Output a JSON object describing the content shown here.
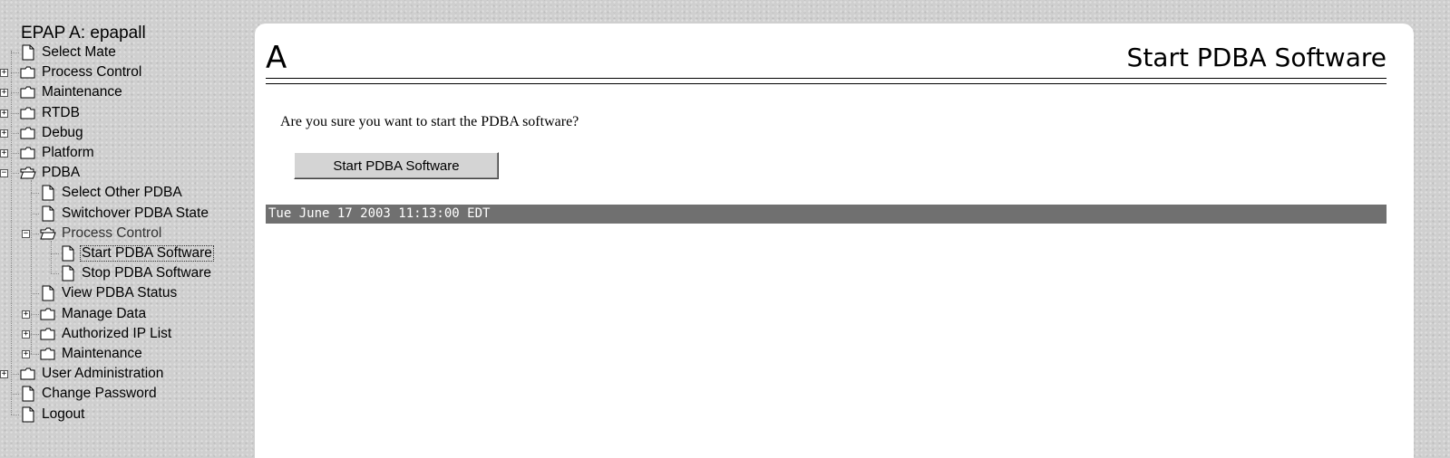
{
  "sidebar": {
    "title": "EPAP A: epapall",
    "items": [
      {
        "label": "Select Mate",
        "type": "page",
        "expander": ""
      },
      {
        "label": "Process Control",
        "type": "folder",
        "expander": "+"
      },
      {
        "label": "Maintenance",
        "type": "folder",
        "expander": "+"
      },
      {
        "label": "RTDB",
        "type": "folder",
        "expander": "+"
      },
      {
        "label": "Debug",
        "type": "folder",
        "expander": "+"
      },
      {
        "label": "Platform",
        "type": "folder",
        "expander": "+"
      },
      {
        "label": "PDBA",
        "type": "folder-open",
        "expander": "−"
      },
      {
        "label": "Select Other PDBA",
        "type": "page",
        "expander": ""
      },
      {
        "label": "Switchover PDBA State",
        "type": "page",
        "expander": ""
      },
      {
        "label": "Process Control",
        "type": "folder-open",
        "expander": "−"
      },
      {
        "label": "Start PDBA Software",
        "type": "page",
        "expander": ""
      },
      {
        "label": "Stop PDBA Software",
        "type": "page",
        "expander": ""
      },
      {
        "label": "View PDBA Status",
        "type": "page",
        "expander": ""
      },
      {
        "label": "Manage Data",
        "type": "folder",
        "expander": "+"
      },
      {
        "label": "Authorized IP List",
        "type": "folder",
        "expander": "+"
      },
      {
        "label": "Maintenance",
        "type": "folder",
        "expander": "+"
      },
      {
        "label": "User Administration",
        "type": "folder",
        "expander": "+"
      },
      {
        "label": "Change Password",
        "type": "page",
        "expander": ""
      },
      {
        "label": "Logout",
        "type": "page",
        "expander": ""
      }
    ]
  },
  "main": {
    "page_letter": "A",
    "heading": "Start PDBA Software",
    "prompt": "Are you sure you want to start the PDBA software?",
    "button_label": "Start PDBA Software",
    "timestamp": "Tue June 17 2003 11:13:00 EDT"
  },
  "colors": {
    "background": "#cfcfcf",
    "panel": "#ffffff",
    "timestamp_bar": "#707070",
    "timestamp_text": "#ffffff"
  }
}
